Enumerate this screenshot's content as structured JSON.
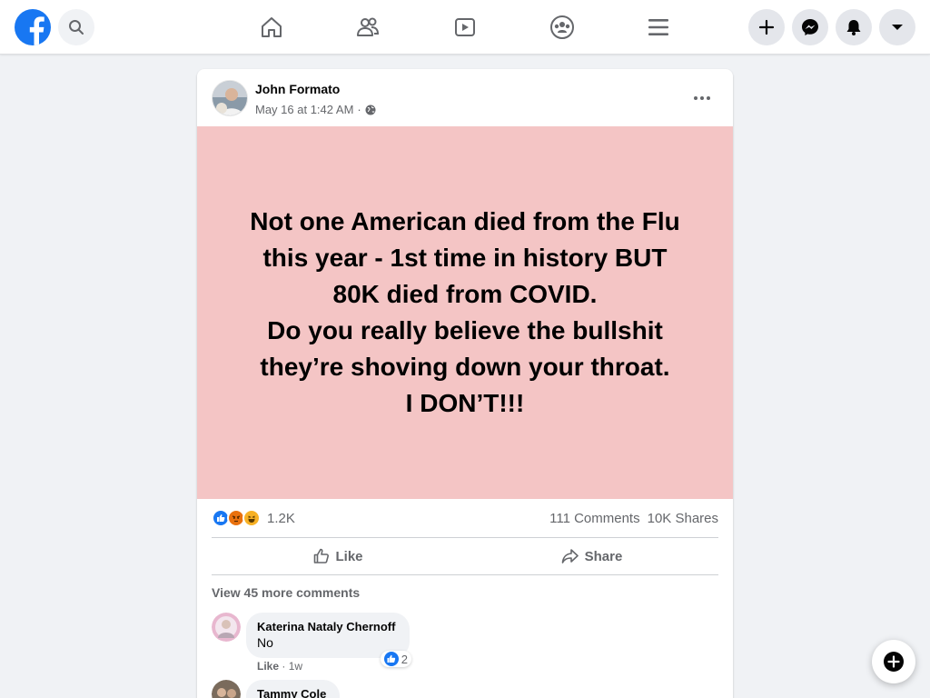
{
  "nav": {
    "logo_icon": "facebook-logo-icon",
    "icons": [
      "search-icon",
      "home-icon",
      "friends-icon",
      "watch-icon",
      "groups-icon",
      "menu-icon",
      "create-icon",
      "messenger-icon",
      "notifications-icon",
      "account-dropdown-icon"
    ],
    "brand_color": "#1877f2"
  },
  "post": {
    "author": "John Formato",
    "time": "May 16 at 1:42 AM",
    "separator": "·",
    "visibility_icon": "globe-icon",
    "text_lines": [
      "Not one American died from the Flu",
      "this year - 1st time in history BUT",
      "80K died from COVID.",
      "Do you really believe the bullshit",
      "they’re shoving down your throat.",
      "I DON’T!!!"
    ],
    "background_color": "#f4c5c5",
    "reaction_icons": [
      "like-reaction-icon",
      "angry-reaction-icon",
      "haha-reaction-icon"
    ],
    "reaction_count": "1.2K",
    "comments_count": "111 Comments",
    "shares_count": "10K Shares",
    "like_label": "Like",
    "share_label": "Share",
    "view_more": "View 45 more comments"
  },
  "comments": [
    {
      "name": "Katerina Nataly Chernoff",
      "text": "No",
      "reaction_count": "2",
      "like_label": "Like",
      "time": "1w"
    },
    {
      "name": "Tammy Cole"
    }
  ]
}
